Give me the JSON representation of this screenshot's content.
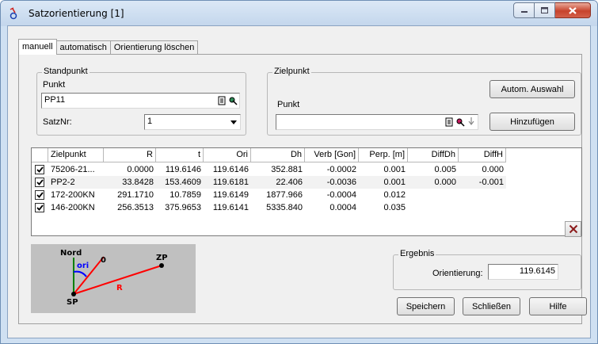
{
  "window": {
    "title": "Satzorientierung [1]"
  },
  "tabs": [
    {
      "label": "manuell",
      "active": true
    },
    {
      "label": "automatisch",
      "active": false
    },
    {
      "label": "Orientierung löschen",
      "active": false
    }
  ],
  "standpunkt": {
    "legend": "Standpunkt",
    "punkt_label": "Punkt",
    "punkt_value": "PP11",
    "satznr_label": "SatzNr:",
    "satznr_value": "1"
  },
  "zielpunkt": {
    "legend": "Zielpunkt",
    "punkt_label": "Punkt",
    "punkt_value": "",
    "auto_button": "Autom. Auswahl",
    "add_button": "Hinzufügen"
  },
  "table": {
    "columns": [
      "",
      "Zielpunkt",
      "R",
      "t",
      "Ori",
      "Dh",
      "Verb [Gon]",
      "Perp. [m]",
      "DiffDh",
      "DiffH"
    ],
    "rows": [
      {
        "checked": true,
        "cells": [
          "75206-21...",
          "0.0000",
          "119.6146",
          "119.6146",
          "352.881",
          "-0.0002",
          "0.001",
          "0.005",
          "0.000"
        ]
      },
      {
        "checked": true,
        "cells": [
          "PP2-2",
          "33.8428",
          "153.4609",
          "119.6181",
          "22.406",
          "-0.0036",
          "0.001",
          "0.000",
          "-0.001"
        ]
      },
      {
        "checked": true,
        "cells": [
          "172-200KN",
          "291.1710",
          "10.7859",
          "119.6149",
          "1877.966",
          "-0.0004",
          "0.012",
          "",
          ""
        ]
      },
      {
        "checked": true,
        "cells": [
          "146-200KN",
          "256.3513",
          "375.9653",
          "119.6141",
          "5335.840",
          "0.0004",
          "0.035",
          "",
          ""
        ]
      }
    ]
  },
  "diagram": {
    "labels": {
      "nord": "Nord",
      "ori": "ori",
      "zero": "0",
      "zp": "ZP",
      "r": "R",
      "sp": "SP"
    },
    "colors": {
      "north": "#008000",
      "ori": "#0000ff",
      "line": "#ff0000",
      "background": "#c0c0c0"
    }
  },
  "ergebnis": {
    "legend": "Ergebnis",
    "label": "Orientierung:",
    "value": "119.6145"
  },
  "buttons": {
    "save": "Speichern",
    "close": "Schließen",
    "help": "Hilfe"
  },
  "icons": [
    "browse-icon",
    "pick-icon",
    "arrow-down-icon",
    "delete-icon",
    "checkbox-checked-icon"
  ]
}
